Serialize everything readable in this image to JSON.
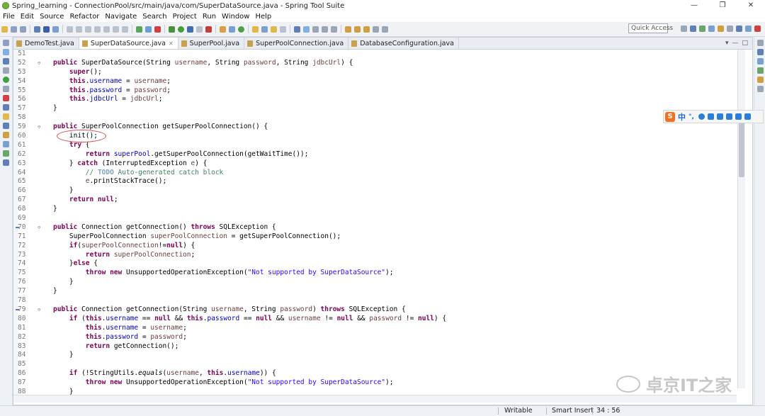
{
  "window": {
    "title": "Spring_learning - ConnectionPool/src/main/java/com/SuperDataSource.java - Spring Tool Suite",
    "minimize": "—",
    "maximize": "❐",
    "close": "✕"
  },
  "menu": [
    "File",
    "Edit",
    "Source",
    "Refactor",
    "Navigate",
    "Search",
    "Project",
    "Run",
    "Window",
    "Help"
  ],
  "toolbar": {
    "quick_access": "Quick Access"
  },
  "tabs": [
    {
      "label": "DemoTest.java",
      "active": false
    },
    {
      "label": "SuperDataSource.java",
      "active": true,
      "close": "✕"
    },
    {
      "label": "SuperPool.java",
      "active": false
    },
    {
      "label": "SuperPoolConnection.java",
      "active": false
    },
    {
      "label": "DatabaseConfiguration.java",
      "active": false
    }
  ],
  "tab_controls": {
    "menu": "▾",
    "minimize": "—",
    "maximize": "□"
  },
  "code": [
    {
      "n": "51",
      "f": "",
      "o": false,
      "t": []
    },
    {
      "n": "52",
      "f": "⊖",
      "o": false,
      "t": [
        [
          "kw",
          "public "
        ],
        [
          "",
          "SuperDataSource(String "
        ],
        [
          "prm",
          "username"
        ],
        [
          "",
          ", String "
        ],
        [
          "prm",
          "password"
        ],
        [
          "",
          ", String "
        ],
        [
          "prm",
          "jdbcUrl"
        ],
        [
          "",
          ") {"
        ]
      ]
    },
    {
      "n": "53",
      "f": "",
      "o": false,
      "t": [
        [
          "",
          "    "
        ],
        [
          "kw",
          "super"
        ],
        [
          "",
          "();"
        ]
      ]
    },
    {
      "n": "54",
      "f": "",
      "o": false,
      "t": [
        [
          "",
          "    "
        ],
        [
          "kw",
          "this"
        ],
        [
          "",
          "."
        ],
        [
          "fld",
          "username"
        ],
        [
          "",
          " = "
        ],
        [
          "prm",
          "username"
        ],
        [
          "",
          ";"
        ]
      ]
    },
    {
      "n": "55",
      "f": "",
      "o": false,
      "t": [
        [
          "",
          "    "
        ],
        [
          "kw",
          "this"
        ],
        [
          "",
          "."
        ],
        [
          "fld",
          "password"
        ],
        [
          "",
          " = "
        ],
        [
          "prm",
          "password"
        ],
        [
          "",
          ";"
        ]
      ]
    },
    {
      "n": "56",
      "f": "",
      "o": false,
      "t": [
        [
          "",
          "    "
        ],
        [
          "kw",
          "this"
        ],
        [
          "",
          "."
        ],
        [
          "fld",
          "jdbcUrl"
        ],
        [
          "",
          " = "
        ],
        [
          "prm",
          "jdbcUrl"
        ],
        [
          "",
          ";"
        ]
      ]
    },
    {
      "n": "57",
      "f": "",
      "o": false,
      "t": [
        [
          "",
          "}"
        ]
      ]
    },
    {
      "n": "58",
      "f": "",
      "o": false,
      "t": []
    },
    {
      "n": "59",
      "f": "⊖",
      "o": false,
      "t": [
        [
          "kw",
          "public "
        ],
        [
          "",
          "SuperPoolConnection getSuperPoolConnection() {"
        ]
      ]
    },
    {
      "n": "60",
      "f": "",
      "o": false,
      "t": [
        [
          "",
          "    init();"
        ]
      ]
    },
    {
      "n": "61",
      "f": "",
      "o": false,
      "t": [
        [
          "",
          "    "
        ],
        [
          "kw",
          "try"
        ],
        [
          "",
          " {"
        ]
      ]
    },
    {
      "n": "62",
      "f": "",
      "o": false,
      "t": [
        [
          "",
          "        "
        ],
        [
          "kw",
          "return "
        ],
        [
          "fld",
          "superPool"
        ],
        [
          "",
          ".getSuperPoolConnection(getWaitTime());"
        ]
      ]
    },
    {
      "n": "63",
      "f": "",
      "o": false,
      "t": [
        [
          "",
          "    } "
        ],
        [
          "kw",
          "catch"
        ],
        [
          "",
          " (InterruptedException "
        ],
        [
          "prm",
          "e"
        ],
        [
          "",
          ") {"
        ]
      ]
    },
    {
      "n": "64",
      "f": "",
      "o": false,
      "t": [
        [
          "",
          "        "
        ],
        [
          "cmt",
          "// "
        ],
        [
          "todo",
          "TODO"
        ],
        [
          "cmt",
          " Auto-generated catch block"
        ]
      ]
    },
    {
      "n": "65",
      "f": "",
      "o": false,
      "t": [
        [
          "",
          "        "
        ],
        [
          "prm",
          "e"
        ],
        [
          "",
          ".printStackTrace();"
        ]
      ]
    },
    {
      "n": "66",
      "f": "",
      "o": false,
      "t": [
        [
          "",
          "    }"
        ]
      ]
    },
    {
      "n": "67",
      "f": "",
      "o": false,
      "t": [
        [
          "",
          "    "
        ],
        [
          "kw",
          "return null"
        ],
        [
          "",
          ";"
        ]
      ]
    },
    {
      "n": "68",
      "f": "",
      "o": false,
      "t": [
        [
          "",
          "}"
        ]
      ]
    },
    {
      "n": "69",
      "f": "",
      "o": false,
      "t": []
    },
    {
      "n": "70",
      "f": "⊖",
      "o": true,
      "t": [
        [
          "kw",
          "public "
        ],
        [
          "",
          "Connection getConnection() "
        ],
        [
          "kw",
          "throws "
        ],
        [
          "",
          "SQLException {"
        ]
      ]
    },
    {
      "n": "71",
      "f": "",
      "o": false,
      "t": [
        [
          "",
          "    SuperPoolConnection "
        ],
        [
          "prm",
          "superPoolConnection"
        ],
        [
          "",
          " = getSuperPoolConnection();"
        ]
      ]
    },
    {
      "n": "72",
      "f": "",
      "o": false,
      "t": [
        [
          "",
          "    "
        ],
        [
          "kw",
          "if"
        ],
        [
          "",
          "("
        ],
        [
          "prm",
          "superPoolConnection"
        ],
        [
          "",
          "!="
        ],
        [
          "kw",
          "null"
        ],
        [
          "",
          ") {"
        ]
      ]
    },
    {
      "n": "73",
      "f": "",
      "o": false,
      "t": [
        [
          "",
          "        "
        ],
        [
          "kw",
          "return "
        ],
        [
          "prm",
          "superPoolConnection"
        ],
        [
          "",
          ";"
        ]
      ]
    },
    {
      "n": "74",
      "f": "",
      "o": false,
      "t": [
        [
          "",
          "    }"
        ],
        [
          "kw",
          "else"
        ],
        [
          "",
          " {"
        ]
      ]
    },
    {
      "n": "75",
      "f": "",
      "o": false,
      "t": [
        [
          "",
          "        "
        ],
        [
          "kw",
          "throw new "
        ],
        [
          "",
          "UnsupportedOperationException("
        ],
        [
          "str",
          "\"Not supported by SuperDataSource\""
        ],
        [
          "",
          ");"
        ]
      ]
    },
    {
      "n": "76",
      "f": "",
      "o": false,
      "t": [
        [
          "",
          "    }"
        ]
      ]
    },
    {
      "n": "77",
      "f": "",
      "o": false,
      "t": [
        [
          "",
          "}"
        ]
      ]
    },
    {
      "n": "78",
      "f": "",
      "o": false,
      "t": []
    },
    {
      "n": "79",
      "f": "⊖",
      "o": true,
      "t": [
        [
          "kw",
          "public "
        ],
        [
          "",
          "Connection getConnection(String "
        ],
        [
          "prm",
          "username"
        ],
        [
          "",
          ", String "
        ],
        [
          "prm",
          "password"
        ],
        [
          "",
          ") "
        ],
        [
          "kw",
          "throws "
        ],
        [
          "",
          "SQLException {"
        ]
      ]
    },
    {
      "n": "80",
      "f": "",
      "o": false,
      "t": [
        [
          "",
          "    "
        ],
        [
          "kw",
          "if"
        ],
        [
          "",
          " ("
        ],
        [
          "kw",
          "this"
        ],
        [
          "",
          "."
        ],
        [
          "fld",
          "username"
        ],
        [
          "",
          " == "
        ],
        [
          "kw",
          "null"
        ],
        [
          "",
          " && "
        ],
        [
          "kw",
          "this"
        ],
        [
          "",
          "."
        ],
        [
          "fld",
          "password"
        ],
        [
          "",
          " == "
        ],
        [
          "kw",
          "null"
        ],
        [
          "",
          " && "
        ],
        [
          "prm",
          "username"
        ],
        [
          "",
          " != "
        ],
        [
          "kw",
          "null"
        ],
        [
          "",
          " && "
        ],
        [
          "prm",
          "password"
        ],
        [
          "",
          " != "
        ],
        [
          "kw",
          "null"
        ],
        [
          "",
          ") {"
        ]
      ]
    },
    {
      "n": "81",
      "f": "",
      "o": false,
      "t": [
        [
          "",
          "        "
        ],
        [
          "kw",
          "this"
        ],
        [
          "",
          "."
        ],
        [
          "fld",
          "username"
        ],
        [
          "",
          " = "
        ],
        [
          "prm",
          "username"
        ],
        [
          "",
          ";"
        ]
      ]
    },
    {
      "n": "82",
      "f": "",
      "o": false,
      "t": [
        [
          "",
          "        "
        ],
        [
          "kw",
          "this"
        ],
        [
          "",
          "."
        ],
        [
          "fld",
          "password"
        ],
        [
          "",
          " = "
        ],
        [
          "prm",
          "password"
        ],
        [
          "",
          ";"
        ]
      ]
    },
    {
      "n": "83",
      "f": "",
      "o": false,
      "t": [
        [
          "",
          "        "
        ],
        [
          "kw",
          "return "
        ],
        [
          "",
          "getConnection();"
        ]
      ]
    },
    {
      "n": "84",
      "f": "",
      "o": false,
      "t": [
        [
          "",
          "    }"
        ]
      ]
    },
    {
      "n": "85",
      "f": "",
      "o": false,
      "t": []
    },
    {
      "n": "86",
      "f": "",
      "o": false,
      "t": [
        [
          "",
          "    "
        ],
        [
          "kw",
          "if"
        ],
        [
          "",
          " (!StringUtils."
        ],
        [
          "st",
          "equals"
        ],
        [
          "",
          "("
        ],
        [
          "prm",
          "username"
        ],
        [
          "",
          ", "
        ],
        [
          "kw",
          "this"
        ],
        [
          "",
          "."
        ],
        [
          "fld",
          "username"
        ],
        [
          "",
          ")) {"
        ]
      ]
    },
    {
      "n": "87",
      "f": "",
      "o": false,
      "t": [
        [
          "",
          "        "
        ],
        [
          "kw",
          "throw new "
        ],
        [
          "",
          "UnsupportedOperationException("
        ],
        [
          "str",
          "\"Not supported by SuperDataSource\""
        ],
        [
          "",
          ");"
        ]
      ]
    },
    {
      "n": "88",
      "f": "",
      "o": false,
      "t": [
        [
          "",
          "    }"
        ]
      ]
    }
  ],
  "status": {
    "mode": "Writable",
    "insert": "Smart Insert",
    "position": "34 : 56"
  },
  "ime": {
    "logo": "S",
    "lang": "中",
    "punct": "°,"
  },
  "watermark": "卓京IT之家",
  "colors": {
    "keyword": "#7f0055",
    "field": "#0000c0",
    "string": "#2a00ff",
    "comment": "#3f7f5f",
    "annotation": "#e05050"
  }
}
